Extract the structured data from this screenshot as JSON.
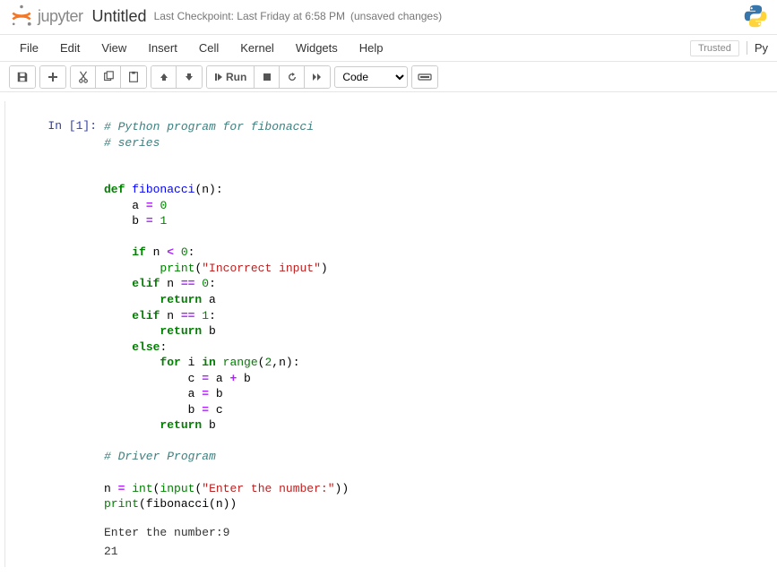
{
  "header": {
    "logo_text": "jupyter",
    "notebook_name": "Untitled",
    "checkpoint": "Last Checkpoint: Last Friday at 6:58 PM",
    "autosave": "(unsaved changes)"
  },
  "menubar": {
    "items": [
      "File",
      "Edit",
      "View",
      "Insert",
      "Cell",
      "Kernel",
      "Widgets",
      "Help"
    ],
    "trusted": "Trusted",
    "kernel_name": "Py"
  },
  "toolbar": {
    "run_label": "Run",
    "cell_type": "Code"
  },
  "cell": {
    "prompt": "In [1]:",
    "code_lines": [
      [
        {
          "t": "# Python program for fibonacci",
          "c": "c-comment"
        }
      ],
      [
        {
          "t": "# series",
          "c": "c-comment"
        }
      ],
      [
        {
          "t": "",
          "c": ""
        }
      ],
      [
        {
          "t": "",
          "c": ""
        }
      ],
      [
        {
          "t": "def ",
          "c": "c-keyword"
        },
        {
          "t": "fibonacci",
          "c": "c-func"
        },
        {
          "t": "(n):",
          "c": "c-punct"
        }
      ],
      [
        {
          "t": "    a ",
          "c": "c-name"
        },
        {
          "t": "=",
          "c": "c-op"
        },
        {
          "t": " ",
          "c": ""
        },
        {
          "t": "0",
          "c": "c-number"
        }
      ],
      [
        {
          "t": "    b ",
          "c": "c-name"
        },
        {
          "t": "=",
          "c": "c-op"
        },
        {
          "t": " ",
          "c": ""
        },
        {
          "t": "1",
          "c": "c-number"
        }
      ],
      [
        {
          "t": "",
          "c": ""
        }
      ],
      [
        {
          "t": "    ",
          "c": ""
        },
        {
          "t": "if",
          "c": "c-keyword"
        },
        {
          "t": " n ",
          "c": "c-name"
        },
        {
          "t": "<",
          "c": "c-op"
        },
        {
          "t": " ",
          "c": ""
        },
        {
          "t": "0",
          "c": "c-number"
        },
        {
          "t": ":",
          "c": "c-punct"
        }
      ],
      [
        {
          "t": "        ",
          "c": ""
        },
        {
          "t": "print",
          "c": "c-builtin"
        },
        {
          "t": "(",
          "c": "c-punct"
        },
        {
          "t": "\"Incorrect input\"",
          "c": "c-string"
        },
        {
          "t": ")",
          "c": "c-punct"
        }
      ],
      [
        {
          "t": "    ",
          "c": ""
        },
        {
          "t": "elif",
          "c": "c-keyword"
        },
        {
          "t": " n ",
          "c": "c-name"
        },
        {
          "t": "==",
          "c": "c-op"
        },
        {
          "t": " ",
          "c": ""
        },
        {
          "t": "0",
          "c": "c-number"
        },
        {
          "t": ":",
          "c": "c-punct"
        }
      ],
      [
        {
          "t": "        ",
          "c": ""
        },
        {
          "t": "return",
          "c": "c-keyword"
        },
        {
          "t": " a",
          "c": "c-name"
        }
      ],
      [
        {
          "t": "    ",
          "c": ""
        },
        {
          "t": "elif",
          "c": "c-keyword"
        },
        {
          "t": " n ",
          "c": "c-name"
        },
        {
          "t": "==",
          "c": "c-op"
        },
        {
          "t": " ",
          "c": ""
        },
        {
          "t": "1",
          "c": "c-number"
        },
        {
          "t": ":",
          "c": "c-punct"
        }
      ],
      [
        {
          "t": "        ",
          "c": ""
        },
        {
          "t": "return",
          "c": "c-keyword"
        },
        {
          "t": " b",
          "c": "c-name"
        }
      ],
      [
        {
          "t": "    ",
          "c": ""
        },
        {
          "t": "else",
          "c": "c-keyword"
        },
        {
          "t": ":",
          "c": "c-punct"
        }
      ],
      [
        {
          "t": "        ",
          "c": ""
        },
        {
          "t": "for",
          "c": "c-keyword"
        },
        {
          "t": " i ",
          "c": "c-name"
        },
        {
          "t": "in",
          "c": "c-keyword"
        },
        {
          "t": " ",
          "c": ""
        },
        {
          "t": "range",
          "c": "c-builtin"
        },
        {
          "t": "(",
          "c": "c-punct"
        },
        {
          "t": "2",
          "c": "c-number"
        },
        {
          "t": ",n):",
          "c": "c-punct"
        }
      ],
      [
        {
          "t": "            c ",
          "c": "c-name"
        },
        {
          "t": "=",
          "c": "c-op"
        },
        {
          "t": " a ",
          "c": "c-name"
        },
        {
          "t": "+",
          "c": "c-op"
        },
        {
          "t": " b",
          "c": "c-name"
        }
      ],
      [
        {
          "t": "            a ",
          "c": "c-name"
        },
        {
          "t": "=",
          "c": "c-op"
        },
        {
          "t": " b",
          "c": "c-name"
        }
      ],
      [
        {
          "t": "            b ",
          "c": "c-name"
        },
        {
          "t": "=",
          "c": "c-op"
        },
        {
          "t": " c",
          "c": "c-name"
        }
      ],
      [
        {
          "t": "        ",
          "c": ""
        },
        {
          "t": "return",
          "c": "c-keyword"
        },
        {
          "t": " b",
          "c": "c-name"
        }
      ],
      [
        {
          "t": "",
          "c": ""
        }
      ],
      [
        {
          "t": "# Driver Program",
          "c": "c-comment"
        }
      ],
      [
        {
          "t": "",
          "c": ""
        }
      ],
      [
        {
          "t": "n ",
          "c": "c-name"
        },
        {
          "t": "=",
          "c": "c-op"
        },
        {
          "t": " ",
          "c": ""
        },
        {
          "t": "int",
          "c": "c-builtin"
        },
        {
          "t": "(",
          "c": "c-punct"
        },
        {
          "t": "input",
          "c": "c-builtin"
        },
        {
          "t": "(",
          "c": "c-punct"
        },
        {
          "t": "\"Enter the number:\"",
          "c": "c-string"
        },
        {
          "t": "))",
          "c": "c-punct"
        }
      ],
      [
        {
          "t": "print",
          "c": "c-builtin"
        },
        {
          "t": "(fibonacci(n))",
          "c": "c-punct"
        }
      ]
    ],
    "output_lines": [
      "Enter the number:9",
      "21"
    ]
  }
}
